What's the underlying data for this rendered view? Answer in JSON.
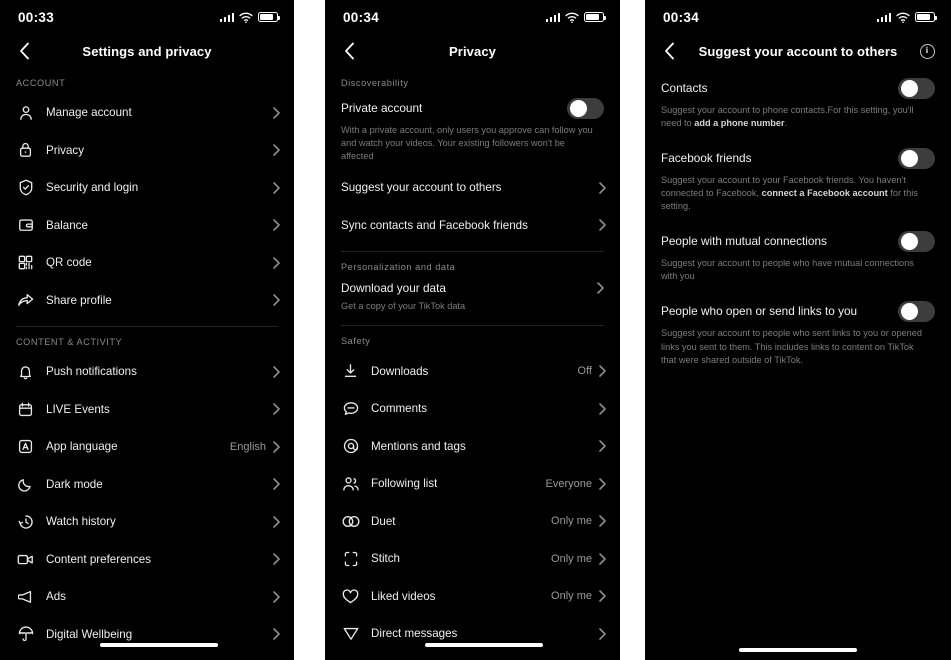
{
  "colors": {
    "background": "#000000",
    "page_gap": "#ffffff",
    "text_primary": "#f0f0f0",
    "text_secondary": "#8a8a8a",
    "toggle_off_track": "#3d3d3d",
    "toggle_knob": "#ffffff",
    "divider": "#242424"
  },
  "panels": [
    {
      "id": "settings",
      "status": {
        "time": "00:33",
        "signal_icon": "signal-bars-icon",
        "wifi_icon": "wifi-icon",
        "battery_icon": "battery-icon"
      },
      "header": {
        "title": "Settings and privacy",
        "back_icon": "chevron-left-icon"
      },
      "sections": [
        {
          "title": "ACCOUNT",
          "rows": [
            {
              "icon": "person-icon",
              "label": "Manage account",
              "value": "",
              "chevron": true
            },
            {
              "icon": "lock-icon",
              "label": "Privacy",
              "value": "",
              "chevron": true
            },
            {
              "icon": "shield-icon",
              "label": "Security and login",
              "value": "",
              "chevron": true
            },
            {
              "icon": "wallet-icon",
              "label": "Balance",
              "value": "",
              "chevron": true
            },
            {
              "icon": "qr-code-icon",
              "label": "QR code",
              "value": "",
              "chevron": true
            },
            {
              "icon": "share-icon",
              "label": "Share profile",
              "value": "",
              "chevron": true
            }
          ]
        },
        {
          "title": "CONTENT & ACTIVITY",
          "rows": [
            {
              "icon": "bell-icon",
              "label": "Push notifications",
              "value": "",
              "chevron": true
            },
            {
              "icon": "calendar-icon",
              "label": "LIVE Events",
              "value": "",
              "chevron": true
            },
            {
              "icon": "language-icon",
              "label": "App language",
              "value": "English",
              "chevron": true
            },
            {
              "icon": "moon-icon",
              "label": "Dark mode",
              "value": "",
              "chevron": true
            },
            {
              "icon": "clock-icon",
              "label": "Watch history",
              "value": "",
              "chevron": true
            },
            {
              "icon": "video-icon",
              "label": "Content preferences",
              "value": "",
              "chevron": true
            },
            {
              "icon": "megaphone-icon",
              "label": "Ads",
              "value": "",
              "chevron": true
            },
            {
              "icon": "umbrella-icon",
              "label": "Digital Wellbeing",
              "value": "",
              "chevron": true
            }
          ]
        }
      ]
    },
    {
      "id": "privacy",
      "status": {
        "time": "00:34",
        "signal_icon": "signal-bars-icon",
        "wifi_icon": "wifi-icon",
        "battery_icon": "battery-icon"
      },
      "header": {
        "title": "Privacy",
        "back_icon": "chevron-left-icon"
      },
      "group_discoverability": {
        "title": "Discoverability",
        "private_account": {
          "title": "Private account",
          "description": "With a private account, only users you approve can follow you and watch your videos. Your existing followers won't be affected",
          "toggle_on": false
        },
        "rows": [
          {
            "icon": "",
            "label": "Suggest your account to others",
            "value": "",
            "chevron": true
          },
          {
            "icon": "",
            "label": "Sync contacts and Facebook friends",
            "value": "",
            "chevron": true
          }
        ]
      },
      "group_personalization": {
        "title": "Personalization and data",
        "download": {
          "label": "Download your data",
          "description": "Get a copy of your TikTok data",
          "chevron": true
        }
      },
      "group_safety": {
        "title": "Safety",
        "rows": [
          {
            "icon": "download-icon",
            "label": "Downloads",
            "value": "Off",
            "chevron": true
          },
          {
            "icon": "comment-icon",
            "label": "Comments",
            "value": "",
            "chevron": true
          },
          {
            "icon": "mention-icon",
            "label": "Mentions and tags",
            "value": "",
            "chevron": true
          },
          {
            "icon": "people-icon",
            "label": "Following list",
            "value": "Everyone",
            "chevron": true
          },
          {
            "icon": "duet-icon",
            "label": "Duet",
            "value": "Only me",
            "chevron": true
          },
          {
            "icon": "stitch-icon",
            "label": "Stitch",
            "value": "Only me",
            "chevron": true
          },
          {
            "icon": "heart-icon",
            "label": "Liked videos",
            "value": "Only me",
            "chevron": true
          },
          {
            "icon": "send-icon",
            "label": "Direct messages",
            "value": "",
            "chevron": true
          }
        ]
      }
    },
    {
      "id": "suggest",
      "status": {
        "time": "00:34",
        "signal_icon": "signal-bars-icon",
        "wifi_icon": "wifi-icon",
        "battery_icon": "battery-icon"
      },
      "header": {
        "title": "Suggest your account to others",
        "back_icon": "chevron-left-icon",
        "info_icon": "info-icon",
        "info_label": "i"
      },
      "toggles": [
        {
          "title": "Contacts",
          "desc_pre": "Suggest your account to phone contacts.For this setting, you'll need to ",
          "desc_link": "add a phone number",
          "desc_post": ".",
          "toggle_on": false
        },
        {
          "title": "Facebook friends",
          "desc_pre": "Suggest your account to your Facebook friends. You haven't connected to Facebook, ",
          "desc_link": "connect a Facebook account",
          "desc_post": " for this setting.",
          "toggle_on": false
        },
        {
          "title": "People with mutual connections",
          "desc_pre": "Suggest your account to people who have mutual connections with you",
          "desc_link": "",
          "desc_post": "",
          "toggle_on": false
        },
        {
          "title": "People who open or send links to you",
          "desc_pre": "Suggest your account to people who sent links to you or opened links you sent to them. This includes links to content on TikTok that were shared outside of TikTok.",
          "desc_link": "",
          "desc_post": "",
          "toggle_on": false
        }
      ]
    }
  ]
}
